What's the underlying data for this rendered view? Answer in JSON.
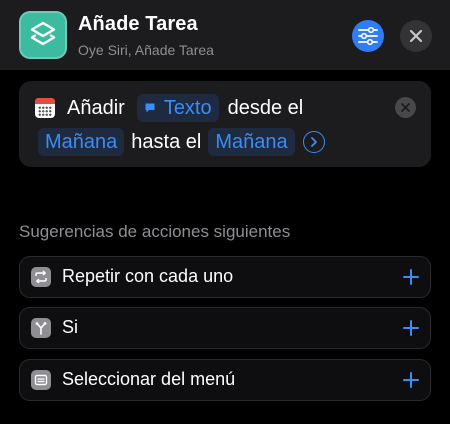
{
  "header": {
    "title": "Añade Tarea",
    "subtitle": "Oye Siri, Añade Tarea",
    "app_icon": "shortcuts-icon",
    "settings_icon": "sliders-icon",
    "close_icon": "close-icon"
  },
  "action": {
    "icon": "calendar-icon",
    "verb": "Añadir",
    "text_token": "Texto",
    "from_label": "desde el",
    "from_token": "Mañana",
    "to_label": "hasta el",
    "to_token": "Mañana",
    "expand_icon": "chevron-right-icon",
    "remove_icon": "close-icon"
  },
  "suggestions": {
    "title": "Sugerencias de acciones siguientes",
    "items": [
      {
        "label": "Repetir con cada uno",
        "icon": "repeat-icon"
      },
      {
        "label": "Si",
        "icon": "branch-icon"
      },
      {
        "label": "Seleccionar del menú",
        "icon": "menu-icon"
      }
    ]
  },
  "colors": {
    "background": "#000000",
    "card": "#1c1c1e",
    "accent": "#2f7cf6",
    "token_text": "#3a8cf6",
    "app_icon": "#3dbba0",
    "secondary_text": "#8e8e93"
  }
}
